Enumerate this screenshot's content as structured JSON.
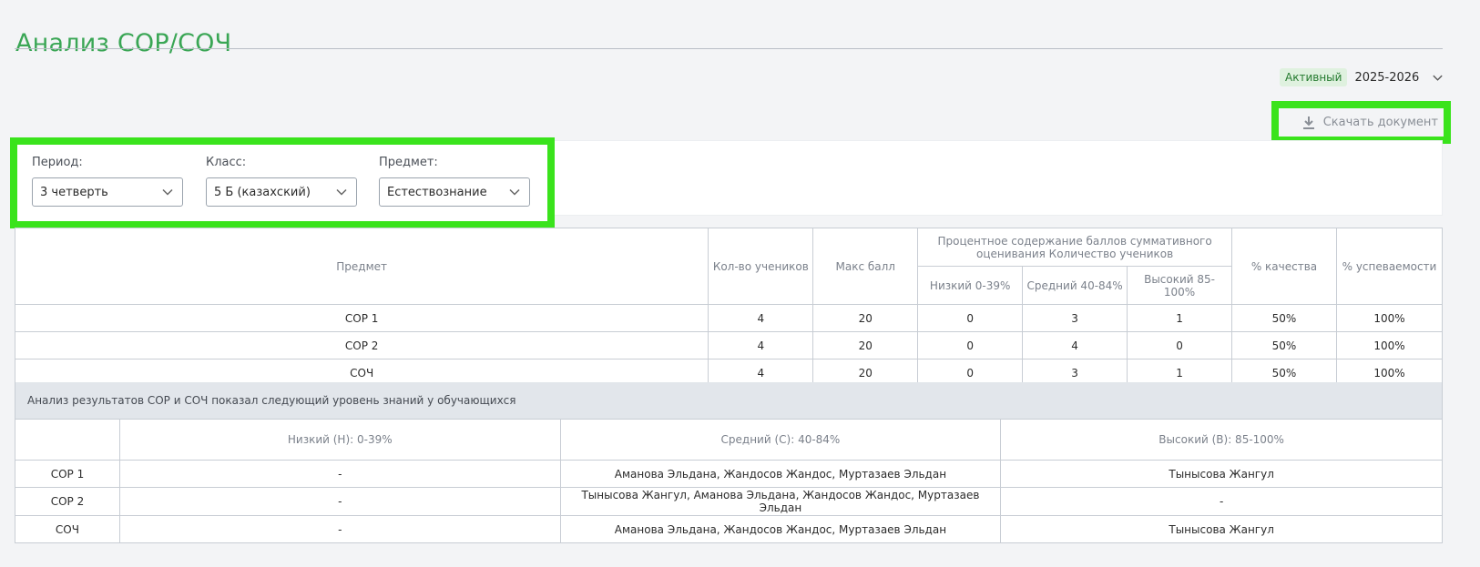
{
  "page": {
    "title": "Анализ СОР/СОЧ"
  },
  "year": {
    "status": "Активный",
    "value": "2025-2026"
  },
  "toolbar": {
    "download_label": "Скачать документ"
  },
  "filters": {
    "period": {
      "label": "Период:",
      "value": "3 четверть"
    },
    "class": {
      "label": "Класс:",
      "value": "5 Б (казахский)"
    },
    "subject": {
      "label": "Предмет:",
      "value": "Естествознание"
    }
  },
  "summary_table": {
    "headers": {
      "subject": "Предмет",
      "students": "Кол-во учеников",
      "max_score": "Макс балл",
      "percent_group": "Процентное содержание баллов суммативного оценивания Количество учеников",
      "low": "Низкий 0-39%",
      "medium": "Средний 40-84%",
      "high": "Высокий 85-100%",
      "quality": "% качества",
      "success": "% успеваемости"
    },
    "rows": [
      {
        "name": "СОР 1",
        "students": "4",
        "max": "20",
        "low": "0",
        "medium": "3",
        "high": "1",
        "quality": "50%",
        "success": "100%"
      },
      {
        "name": "СОР 2",
        "students": "4",
        "max": "20",
        "low": "0",
        "medium": "4",
        "high": "0",
        "quality": "50%",
        "success": "100%"
      },
      {
        "name": "СОЧ",
        "students": "4",
        "max": "20",
        "low": "0",
        "medium": "3",
        "high": "1",
        "quality": "50%",
        "success": "100%"
      }
    ]
  },
  "analysis": {
    "caption": "Анализ результатов СОР и СОЧ показал следующий уровень знаний у обучающихся",
    "headers": {
      "empty": "",
      "low": "Низкий (Н): 0-39%",
      "medium": "Средний (С): 40-84%",
      "high": "Высокий (В): 85-100%"
    },
    "rows": [
      {
        "name": "СОР 1",
        "low": "-",
        "medium": "Аманова Эльдана, Жандосов Жандос, Муртазаев Эльдан",
        "high": "Тынысова Жангул"
      },
      {
        "name": "СОР 2",
        "low": "-",
        "medium": "Тынысова Жангул, Аманова Эльдана, Жандосов Жандос, Муртазаев Эльдан",
        "high": "-"
      },
      {
        "name": "СОЧ",
        "low": "-",
        "medium": "Аманова Эльдана, Жандосов Жандос, Муртазаев Эльдан",
        "high": "Тынысова Жангул"
      }
    ]
  },
  "colors": {
    "accent": "#3aa655",
    "highlight": "#3ae31c",
    "status_bg": "#dff1df"
  },
  "icons": {
    "download": "download-icon",
    "dropdown": "chevron-down-icon"
  }
}
